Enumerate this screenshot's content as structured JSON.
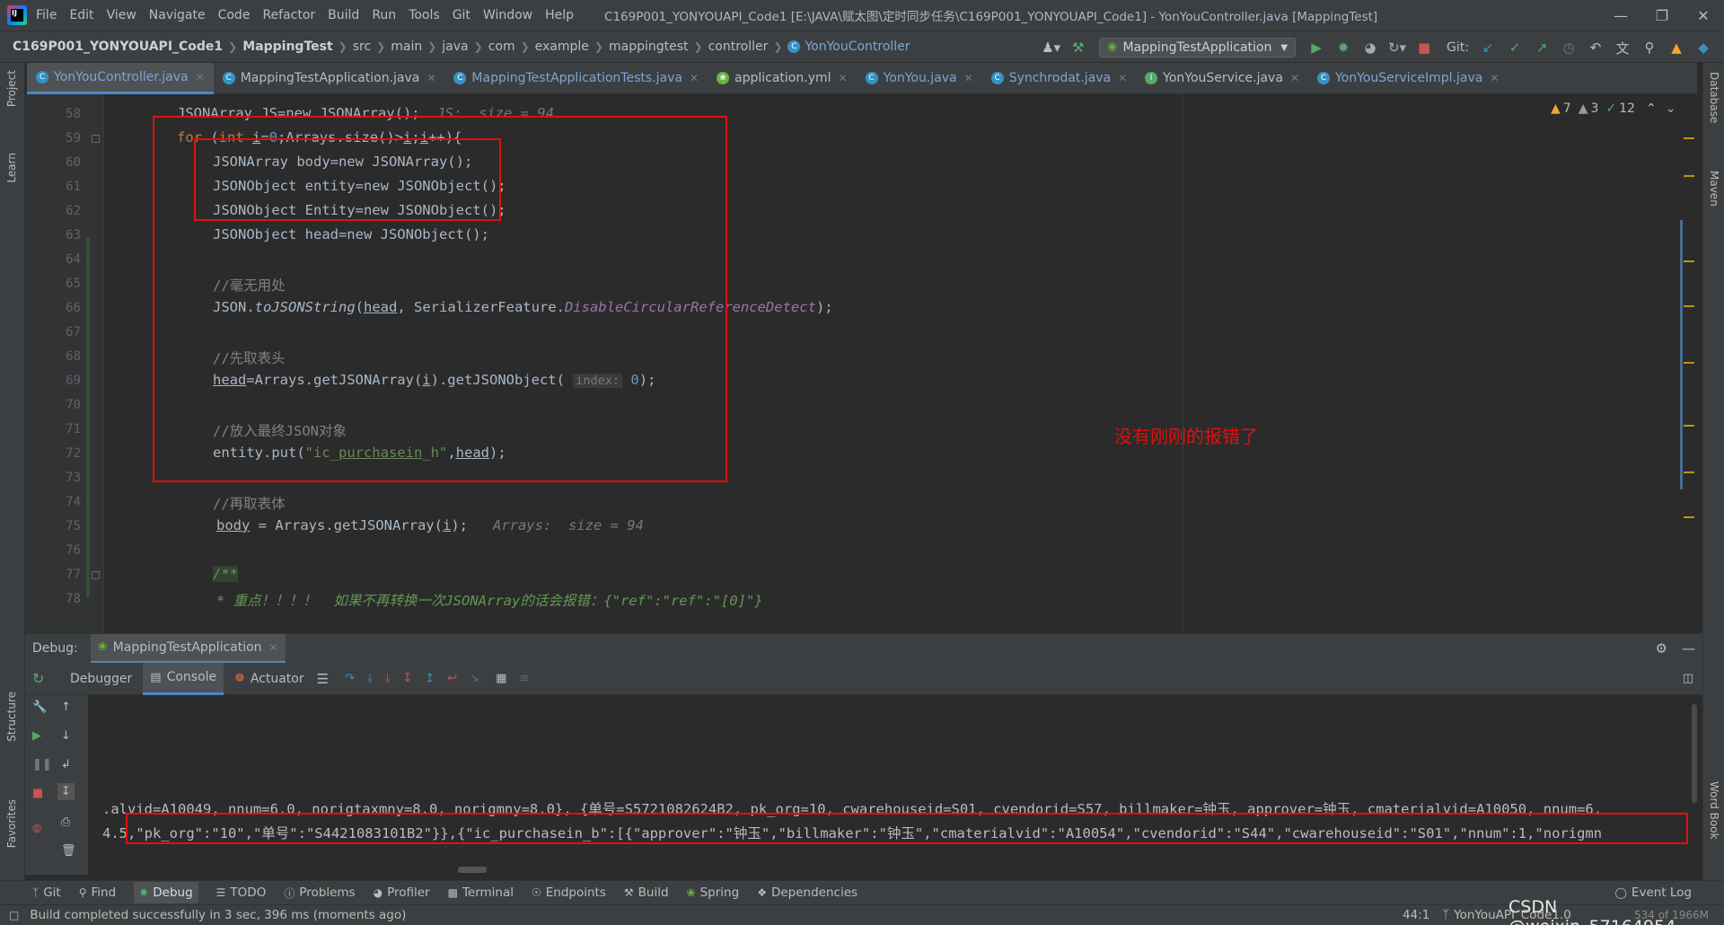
{
  "titlebar": {
    "menu": [
      "File",
      "Edit",
      "View",
      "Navigate",
      "Code",
      "Refactor",
      "Build",
      "Run",
      "Tools",
      "Git",
      "Window",
      "Help"
    ],
    "title": "C169P001_YONYOUAPI_Code1 [E:\\JAVA\\赋太图\\定时同步任务\\C169P001_YONYOUAPI_Code1] - YonYouController.java [MappingTest]"
  },
  "breadcrumb": {
    "project": "C169P001_YONYOUAPI_Code1",
    "module": "MappingTest",
    "items": [
      "src",
      "main",
      "java",
      "com",
      "example",
      "mappingtest",
      "controller"
    ],
    "current": "YonYouController"
  },
  "toolbar": {
    "run_config": "MappingTestApplication",
    "git_label": "Git:"
  },
  "tabs": [
    {
      "label": "YonYouController.java",
      "active": true
    },
    {
      "label": "MappingTestApplication.java"
    },
    {
      "label": "MappingTestApplicationTests.java"
    },
    {
      "label": "application.yml"
    },
    {
      "label": "YonYou.java"
    },
    {
      "label": "Synchrodat.java"
    },
    {
      "label": "YonYouService.java"
    },
    {
      "label": "YonYouServiceImpl.java"
    }
  ],
  "inspections": {
    "warnings": "7",
    "weak_warnings": "3",
    "ok": "12"
  },
  "line_numbers": [
    "58",
    "59",
    "60",
    "61",
    "62",
    "63",
    "64",
    "65",
    "66",
    "67",
    "68",
    "69",
    "70",
    "71",
    "72",
    "73",
    "74",
    "75",
    "76",
    "77",
    "78"
  ],
  "code": {
    "l58_text": "JSONArray JS=new JSONArray();",
    "l58_hint": "JS:  size = 94",
    "l60": "JSONArray body=new JSONArray();",
    "l61": "JSONObject entity=new JSONObject();",
    "l62": "JSONObject Entity=new JSONObject();",
    "l63": "JSONObject head=new JSONObject();",
    "c65": "//毫无用处",
    "c68": "//先取表头",
    "c71": "//放入最终JSON对象",
    "c74": "//再取表体",
    "l75_hint": "Arrays:  size = 94",
    "l78": "* 重点！！！！  如果不再转换一次JSONArray的话会报错：{\"ref\":\"ref\":\"[0]\"}"
  },
  "annotation": "没有刚刚的报错了",
  "debug": {
    "label": "Debug:",
    "session": "MappingTestApplication",
    "tabs": [
      "Debugger",
      "Console",
      "Actuator"
    ],
    "console_lines": [
      ".alvid=A10049, nnum=6.0, norigtaxmny=8.0, norigmny=8.0}, {单号=S5721082624B2, pk_org=10, cwarehouseid=S01, cvendorid=S57, billmaker=钟玉, approver=钟玉, cmaterialvid=A10050, nnum=6.",
      "4.5,\"pk_org\":\"10\",\"单号\":\"S4421083101B2\"}},{\"ic_purchasein_b\":[{\"approver\":\"钟玉\",\"billmaker\":\"钟玉\",\"cmaterialvid\":\"A10054\",\"cvendorid\":\"S44\",\"cwarehouseid\":\"S01\",\"nnum\":1,\"norigmn"
    ]
  },
  "left_strip": [
    "Project",
    "Learn",
    "Structure",
    "Favorites"
  ],
  "right_strip": [
    "Database",
    "Maven",
    "Word Book"
  ],
  "bottom_tools": [
    "Git",
    "Find",
    "Debug",
    "TODO",
    "Problems",
    "Profiler",
    "Terminal",
    "Endpoints",
    "Build",
    "Spring",
    "Dependencies"
  ],
  "event_log": "Event Log",
  "status": {
    "message": "Build completed successfully in 3 sec, 396 ms (moments ago)",
    "position": "44:1",
    "branch": "YonYouAPI_Code1.0",
    "memory": "534 of 1966M",
    "watermark": "CSDN @weixin_57164954"
  },
  "colors": {
    "accent": "#4a88c7",
    "annotation_red": "#e01010",
    "keyword": "#cc7832"
  }
}
